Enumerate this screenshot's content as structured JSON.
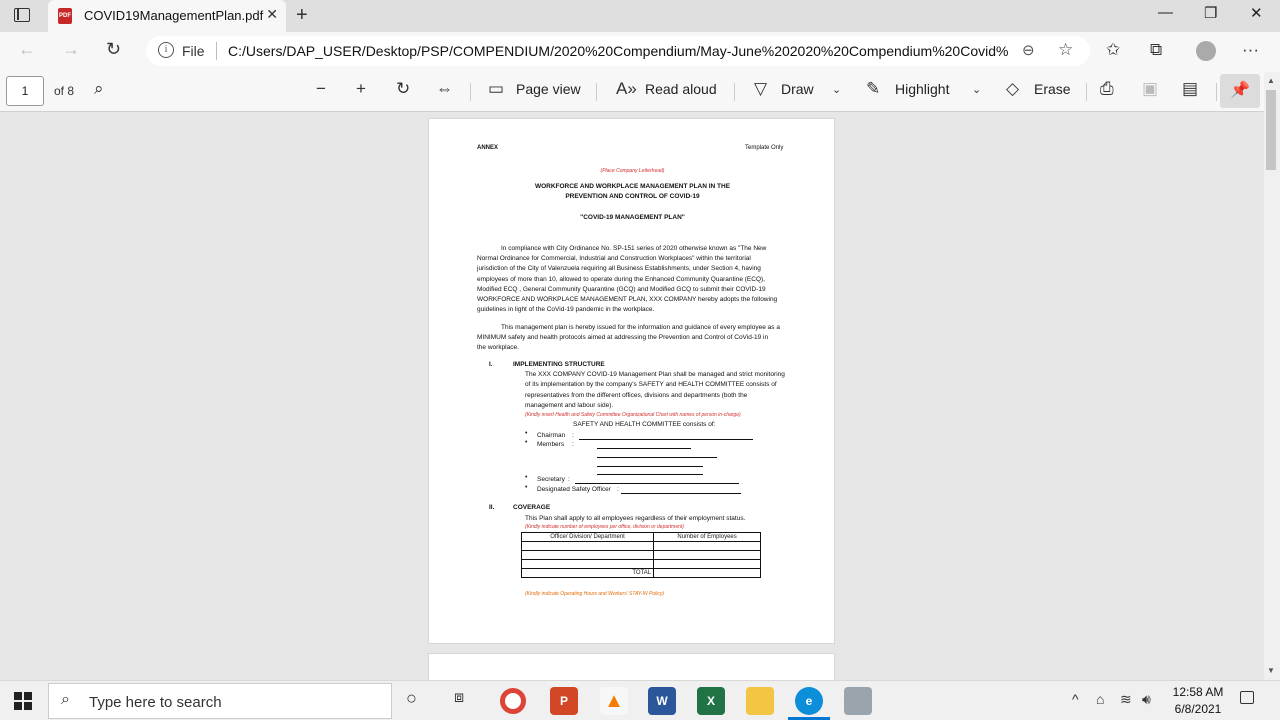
{
  "browser": {
    "tab_title": "COVID19ManagementPlan.pdf",
    "tab_close": "✕",
    "new_tab": "+",
    "address": {
      "scheme_label": "File",
      "url": "C:/Users/DAP_USER/Desktop/PSP/COMPENDIUM/2020%20Compendium/May-June%202020%20Compendium%20Covid%2..."
    }
  },
  "pdf_toolbar": {
    "page_number": "1",
    "page_count": "of 8",
    "page_view": "Page view",
    "read_aloud": "Read aloud",
    "draw": "Draw",
    "highlight": "Highlight",
    "erase": "Erase"
  },
  "document": {
    "annex": "ANNEX",
    "template_only": "Template Only",
    "letterhead": "(Place Company Letterhead)",
    "title_line1": "WORKFORCE AND WORKPLACE MANAGEMENT PLAN IN THE",
    "title_line2": "PREVENTION AND CONTROL OF COVID-19",
    "subtitle": "\"COVID-19 MANAGEMENT PLAN\"",
    "p1": [
      "In compliance with City Ordinance No. SP-151 series of 2020 otherwise known as \"The New",
      "Normal Ordinance for Commercial, Industrial and Construction Workplaces\" within the territorial",
      "jurisdiction of the City of Valenzuela requiring all Business Establishments, under Section 4, having",
      "employees of more than 10, allowed to operate during the Enhanced Community Quarantine (ECQ),",
      "Modified ECQ , General Community Quarantine (GCQ) and Modified GCQ to submit their COVID-19",
      "WORKFORCE AND WORKPLACE MANAGEMENT PLAN, XXX COMPANY hereby adopts the following",
      "guidelines in light of the CoVid-19 pandemic in the workplace."
    ],
    "p2": [
      "This management plan is hereby issued for the information and guidance of every employee as a",
      "MINIMUM safety and health protocols aimed at addressing the Prevention and Control of CoVid-19 in",
      "the workplace."
    ],
    "sec1_num": "I.",
    "sec1_title": "IMPLEMENTING STRUCTURE",
    "sec1_text": [
      "The XXX COMPANY COVID-19 Management Plan shall be managed and strict monitoring",
      "of its implementation by the company's SAFETY and HEALTH COMMITTEE consists of",
      "representatives from the different offices, divisions and departments (both the",
      "management and labour side)."
    ],
    "sec1_note": "(Kindly insert Health and Safety Committee Organizational Chart with names of person in-charge)",
    "committee_intro": "SAFETY AND HEALTH COMMITTEE consists of:",
    "chairman": "Chairman",
    "members": "Members",
    "secretary": "Secretary",
    "safety_officer": "Designated Safety Officer",
    "colon": ":",
    "sec2_num": "II.",
    "sec2_title": "COVERAGE",
    "sec2_text": "This Plan shall apply to all employees regardless of their employment status.",
    "sec2_note": "(Kindly indicate number of employees per office, division or department)",
    "table_headers": [
      "Office/ Division/ Department",
      "Number of Employees"
    ],
    "table_total": "TOTAL",
    "footer_note": "(Kindly indicate Operating Hours and Workers' STAY-IN Policy)"
  },
  "taskbar": {
    "search_placeholder": "Type here to search",
    "time": "12:58 AM",
    "date": "6/8/2021"
  }
}
